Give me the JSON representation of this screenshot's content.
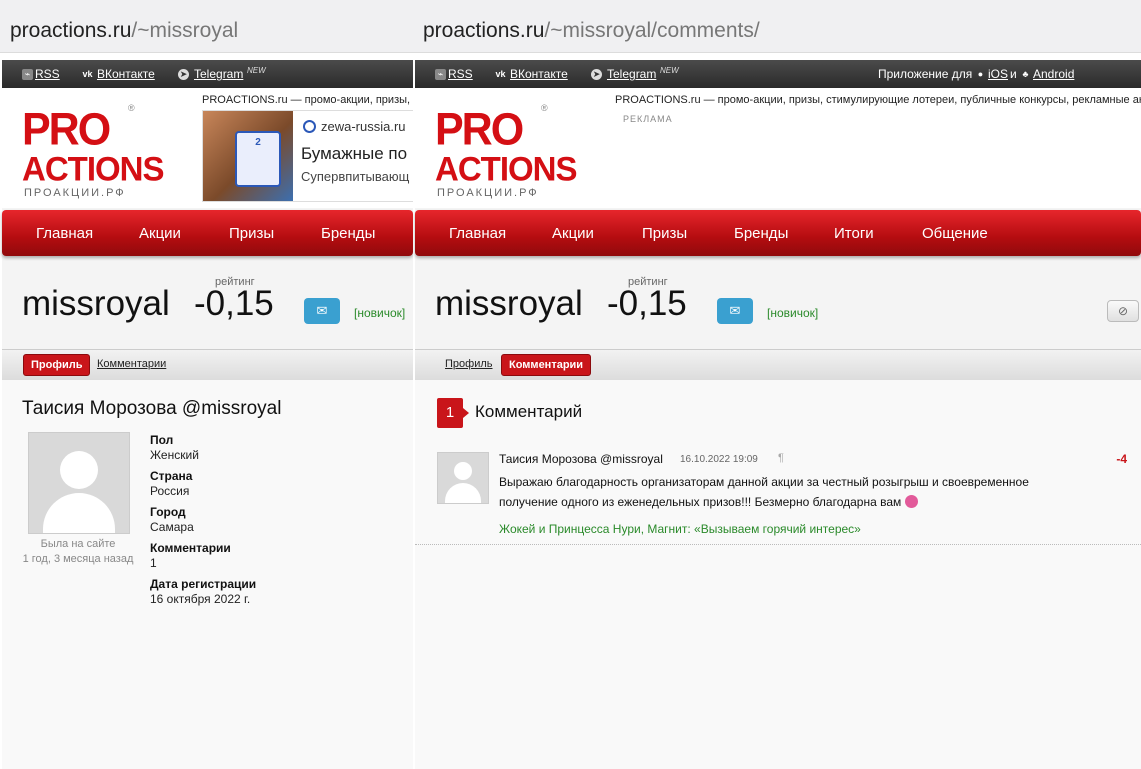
{
  "left": {
    "url_host": "proactions.ru",
    "url_path": "/~missroyal",
    "topbar": {
      "rss": "RSS",
      "vk": "ВКонтакте",
      "telegram": "Telegram",
      "new": "NEW"
    },
    "logo": {
      "line1": "PRO",
      "line2": "ACTIONS",
      "line3": "ПРОАКЦИИ.РФ",
      "reg": "®"
    },
    "tagline": "PROACTIONS.ru — промо-акции, призы, с",
    "ad": {
      "domain": "zewa-russia.ru",
      "title": "Бумажные по",
      "desc": "Супервпитывающ",
      "pack_text": "2"
    },
    "menu": [
      "Главная",
      "Акции",
      "Призы",
      "Бренды"
    ],
    "username": "missroyal",
    "rating_label": "рейтинг",
    "rating_value": "-0,15",
    "badge": "[новичок]",
    "tabs": {
      "profile": "Профиль",
      "comments": "Комментарии"
    },
    "fullname": "Таисия Морозова @missroyal",
    "seen_label": "Была на сайте",
    "seen_value": "1 год, 3 месяца назад",
    "info": [
      {
        "label": "Пол",
        "value": "Женский"
      },
      {
        "label": "Страна",
        "value": "Россия"
      },
      {
        "label": "Город",
        "value": "Самара"
      },
      {
        "label": "Комментарии",
        "value": "1"
      },
      {
        "label": "Дата регистрации",
        "value": "16 октября 2022 г."
      }
    ]
  },
  "right": {
    "url_host": "proactions.ru",
    "url_path": "/~missroyal/comments/",
    "topbar": {
      "rss": "RSS",
      "vk": "ВКонтакте",
      "telegram": "Telegram",
      "new": "NEW",
      "app_prefix": "Приложение для",
      "ios": "iOS",
      "and": "и",
      "android": "Android"
    },
    "logo": {
      "line1": "PRO",
      "line2": "ACTIONS",
      "line3": "ПРОАКЦИИ.РФ",
      "reg": "®"
    },
    "tagline": "PROACTIONS.ru — промо-акции, призы, стимулирующие лотереи, публичные конкурсы, рекламные акц",
    "ad_label": "РЕКЛАМА",
    "menu": [
      "Главная",
      "Акции",
      "Призы",
      "Бренды",
      "Итоги",
      "Общение"
    ],
    "username": "missroyal",
    "rating_label": "рейтинг",
    "rating_value": "-0,15",
    "badge": "[новичок]",
    "block_icon": "⊘",
    "tabs": {
      "profile": "Профиль",
      "comments": "Комментарии"
    },
    "comments_count": "1",
    "comments_title": "Комментарий",
    "comment": {
      "author": "Таисия Морозова @missroyal",
      "date": "16.10.2022 19:09",
      "pilcrow": "¶",
      "score": "-4",
      "text": "Выражаю благодарность организаторам данной акции за честный розыгрыш и своевременное получение одного из еженедельных призов!!! Безмерно благодарна вам",
      "link": "Жокей и Принцесса Нури, Магнит: «Вызываем горячий интерес»"
    }
  },
  "icons": {
    "rss": "rss-icon",
    "vk": "vk-icon",
    "telegram": "telegram-icon",
    "mail": "mail-icon",
    "apple": "apple-icon",
    "android": "android-icon"
  }
}
